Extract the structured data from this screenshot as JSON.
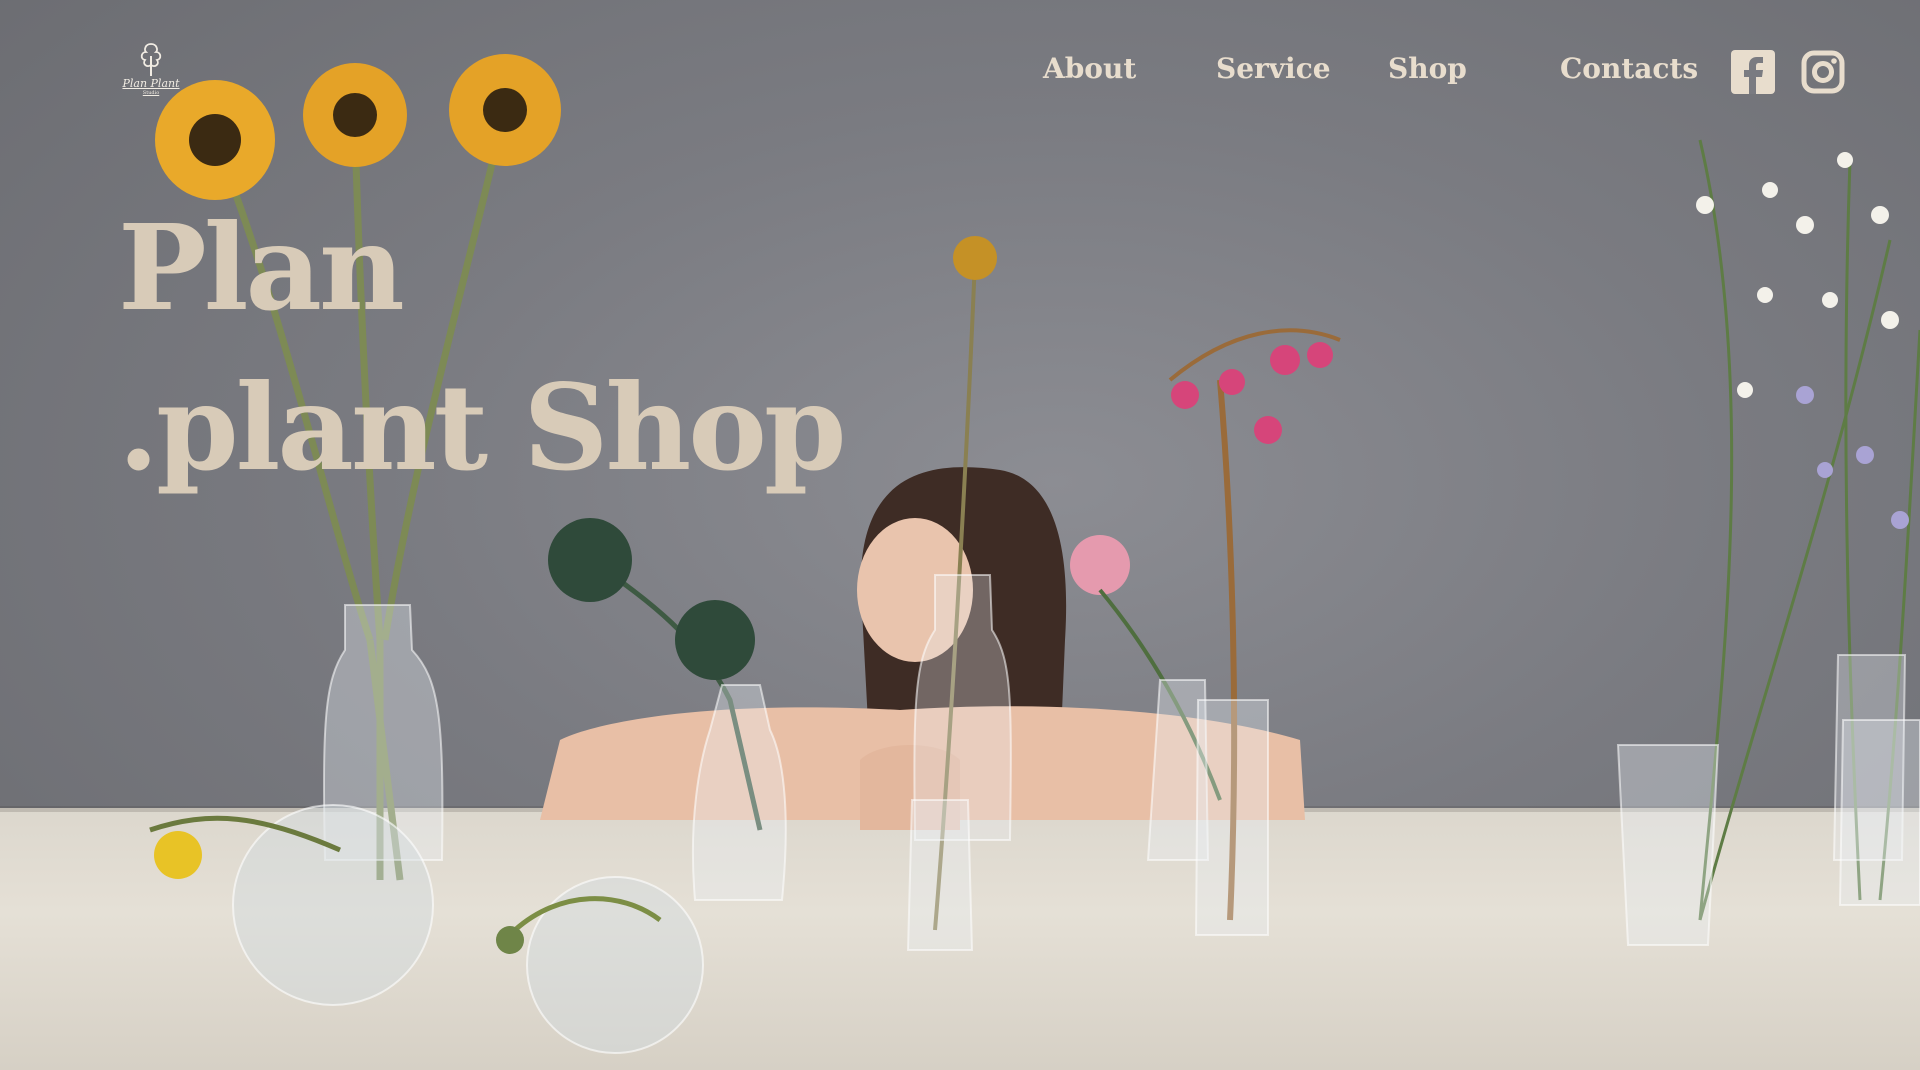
{
  "brand": {
    "name": "Plan Plant",
    "tagline": "Studio",
    "logo_icon": "tree-icon"
  },
  "nav": {
    "items": [
      {
        "label": "About"
      },
      {
        "label": "Service"
      },
      {
        "label": "Shop"
      },
      {
        "label": "Contacts"
      }
    ],
    "social": [
      {
        "icon": "facebook-icon"
      },
      {
        "icon": "instagram-icon"
      }
    ]
  },
  "hero": {
    "line1": "Plan",
    "line2": ".plant Shop"
  },
  "colors": {
    "wall": "#7a7b81",
    "table": "#e0dbd1",
    "heading": "#d8cbb8",
    "nav_text": "#e8ddcd"
  }
}
